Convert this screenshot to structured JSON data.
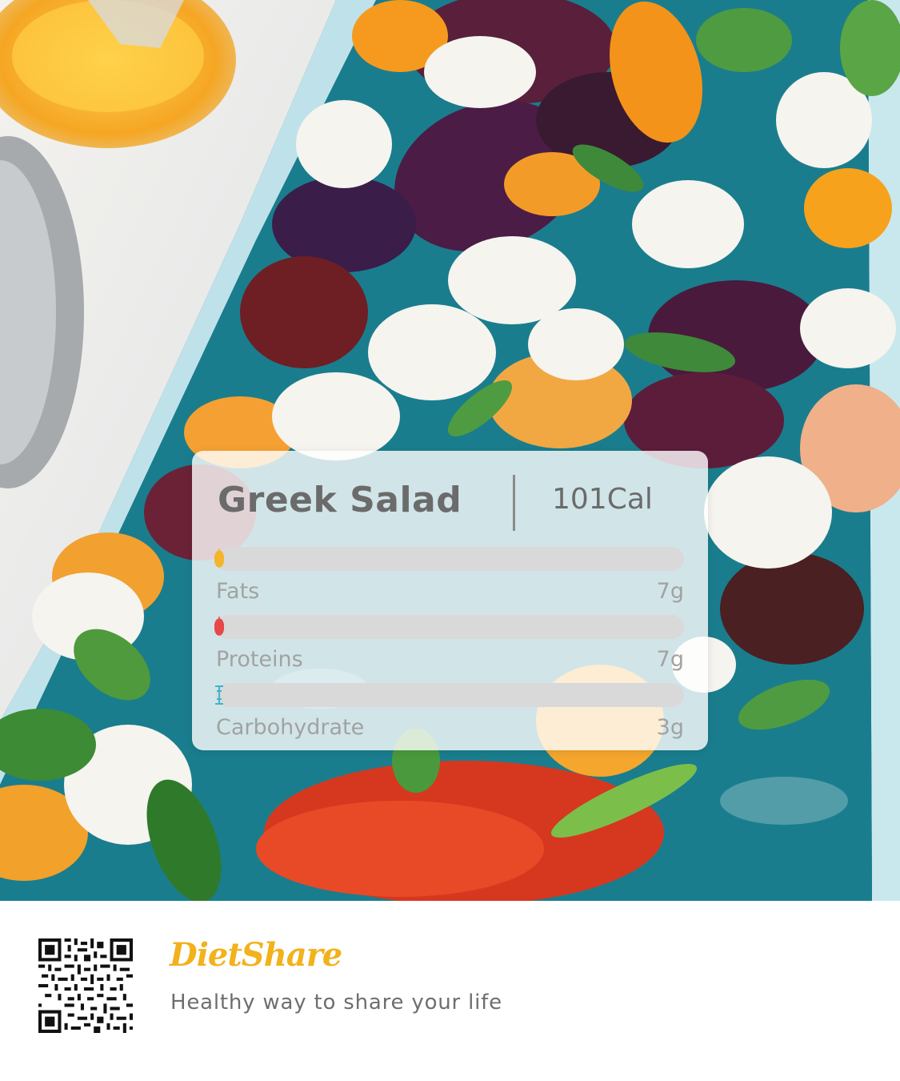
{
  "card": {
    "title": "Greek Salad",
    "calories": "101Cal",
    "nutrients": [
      {
        "label": "Fats",
        "value": "7g",
        "color": "#f5b52b",
        "fill_fraction": 0.0
      },
      {
        "label": "Proteins",
        "value": "7g",
        "color": "#e8474b",
        "fill_fraction": 0.0
      },
      {
        "label": "Carbohydrate",
        "value": "3g",
        "color": "#3fb5c9",
        "fill_fraction": 0.0
      }
    ]
  },
  "footer": {
    "brand": "DietShare",
    "tagline": "Healthy way to share your life",
    "brand_color": "#f2b21c"
  },
  "icons": {
    "qr": "qr-code-icon"
  }
}
